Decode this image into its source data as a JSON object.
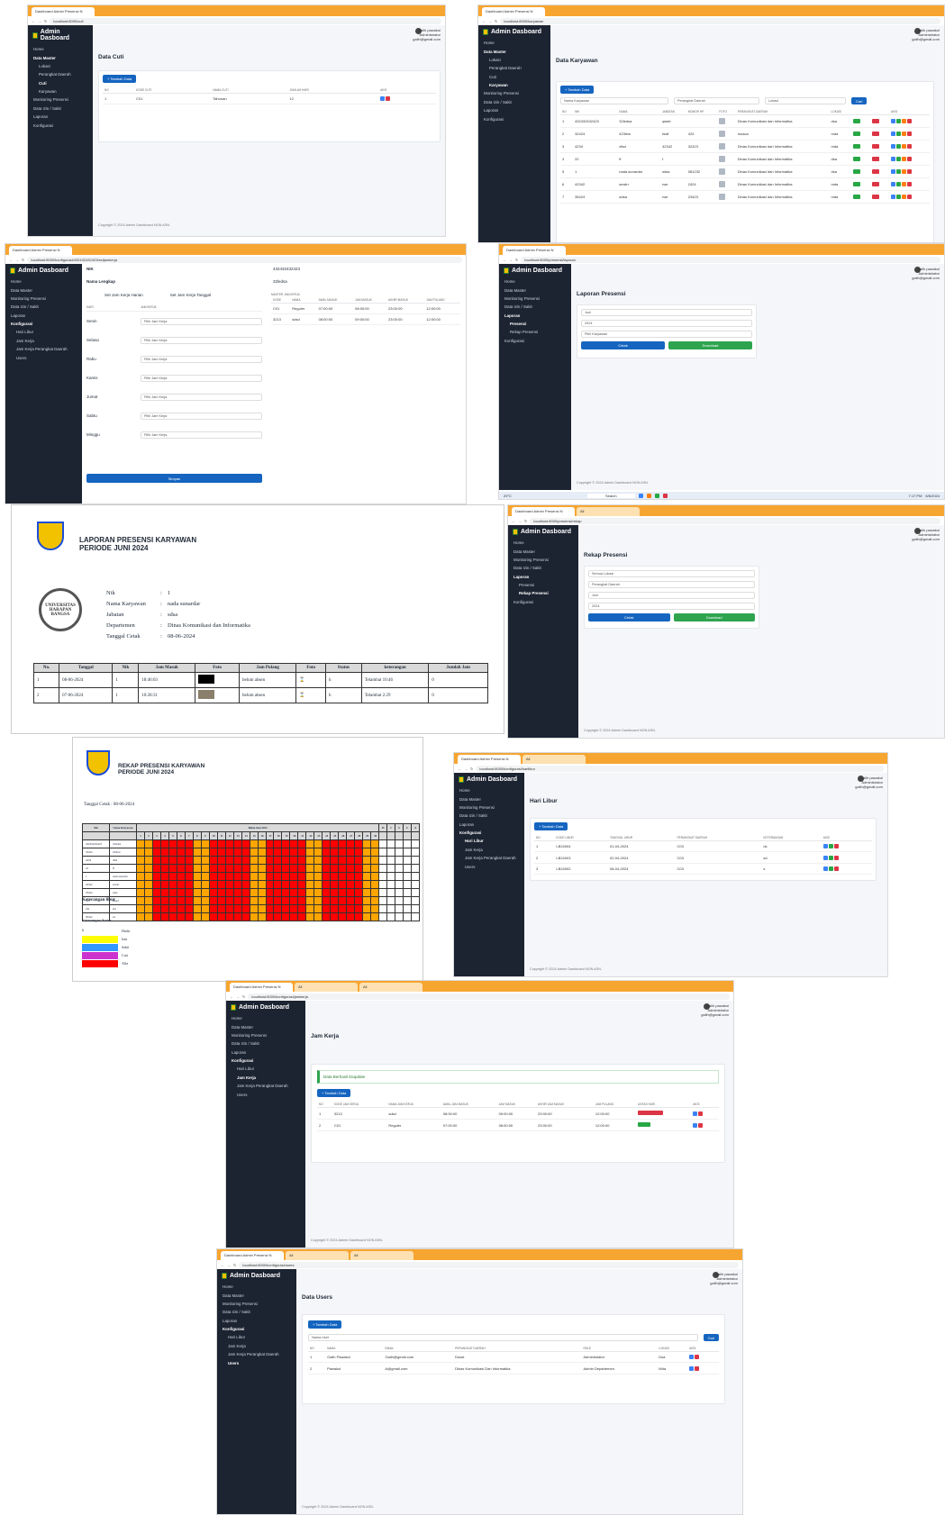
{
  "brand": "Admin Dasboard",
  "user": {
    "name": "galih pawakol",
    "role": "Administrator",
    "email": "galih@gmail.com"
  },
  "footer": "Copyright © 2024 Admin Dashboard NON ASN.",
  "colors": {
    "sidebar": "#1c2331",
    "chrome": "#f7a531",
    "primary": "#1565c0",
    "success": "#2ea44f",
    "danger": "#dc3545",
    "absent": "#ff0000",
    "weekend": "#ffa500"
  },
  "tabs": {
    "main": "Dashboard Admin Presensi N",
    "blank": "All"
  },
  "sidebar": {
    "home": "Home",
    "data_master": "Data Master",
    "lokasi": "Lokasi",
    "perangkat": "Perangkat Daerah",
    "cuti": "Cuti",
    "karyawan": "Karyawan",
    "monitoring": "Monitoring Presensi",
    "izin": "Data Izin / Sakit",
    "laporan": "Laporan",
    "presensi": "Presensi",
    "rekap": "Rekap Presensi",
    "konfigurasi": "Konfigurasi",
    "hari_libur": "Hari Libur",
    "jam_kerja": "Jam Kerja",
    "jam_kerja_pd": "Jam Kerja Perangkat Daerah",
    "users": "Users"
  },
  "s1": {
    "url": "localhost:8000/cuti",
    "title": "Data Cuti",
    "add": "+ Tambah Data",
    "headers": [
      "NO",
      "KODE CUTI",
      "NAMA CUTI",
      "JUMLAH HARI",
      "AKSI"
    ],
    "rows": [
      [
        "1",
        "C01",
        "Tahunan",
        "12"
      ]
    ]
  },
  "s2": {
    "url": "localhost:8000/karyawan",
    "title": "Data Karyawan",
    "add": "+ Tambah Data",
    "search_ph": "Nama Karyawan",
    "pd_ph": "Perangkat Daerah",
    "lok_ph": "Lokasi",
    "cari": "Cari",
    "headers": [
      "NO",
      "NIK",
      "NAMA",
      "JABATAN",
      "NOMOR HP",
      "FOTO",
      "PERANGKAT DAERAH",
      "LOKASI",
      "",
      "",
      "AKSI"
    ],
    "rows": [
      [
        "1",
        "432432432423",
        "32ledsa",
        "qwde",
        "",
        "Dinas Komunikasi dan Informatika",
        "dsa"
      ],
      [
        "2",
        "32424",
        "423lew",
        "fwdf",
        "424",
        "rocaca",
        "mda"
      ],
      [
        "3",
        "4234",
        "dfsd",
        "42342",
        "32423",
        "Dinas Komunikasi dan Informatika",
        "mda"
      ],
      [
        "4",
        "22",
        "ff",
        "f",
        "",
        "Dinas Komunikasi dan Informatika",
        "dsa"
      ],
      [
        "5",
        "1",
        "nada sunardar",
        "sdsa",
        "081232",
        "Dinas Komunikasi dan Informatika",
        "dsa"
      ],
      [
        "6",
        "42342",
        "sewlrr",
        "rwe",
        "2424",
        "Dinas Komunikasi dan Informatika",
        "mda"
      ],
      [
        "7",
        "35424",
        "adsa",
        "rwe",
        "23423",
        "Dinas Komunikasi dan Informatika",
        "mda"
      ]
    ]
  },
  "s3": {
    "url": "localhost:8000/konfigurasi/432432432423/setjamkerja",
    "nik_label": "NIK",
    "nik": "432432432423",
    "nama_label": "Nama Lengkap",
    "nama": "32ledsa",
    "tab1": "Set Jam Kerja Harian",
    "tab2": "Set Jam Kerja Tanggal",
    "col_hari": "HARI",
    "col_jam": "JAM KERJA",
    "days": [
      "Senin",
      "Selasa",
      "Rabu",
      "Kamis",
      "Jumat",
      "Sabtu",
      "Minggu"
    ],
    "pick": "Pilih Jam Kerja",
    "save": "Simpan",
    "master_title": "MASTER JAM KERJA",
    "master_headers": [
      "KODE",
      "NAMA",
      "AWAL MASUK",
      "JAM MASUK",
      "AKHIR MASUK",
      "JAM PULANG"
    ],
    "master_rows": [
      [
        "C01",
        "Reguler",
        "07:00:00",
        "08:00:00",
        "23:00:00",
        "12:00:00"
      ],
      [
        "3213",
        "sdsd",
        "08:00:00",
        "09:00:00",
        "23:00:00",
        "12:00:00"
      ]
    ]
  },
  "s4": {
    "url": "localhost:8000/presensi/laporan",
    "title": "Laporan Presensi",
    "bulan": "Juni",
    "tahun": "2024",
    "karyawan": "Pilih Karyawan",
    "cetak": "Cetak",
    "download": "Download",
    "weather": "29°C",
    "time": "7:17 PM",
    "date": "6/6/2024",
    "search": "Search"
  },
  "doc1": {
    "title1": "LAPORAN PRESENSI KARYAWAN",
    "title2": "PERIODE JUNI 2024",
    "seal": "UNIVERSITAS HARAPAN BANGSA",
    "fields": [
      [
        "Nik",
        ":",
        "1"
      ],
      [
        "Nama Karyawan",
        ":",
        "nada sunardar"
      ],
      [
        "Jabatan",
        ":",
        "sdsa"
      ],
      [
        "Departemen",
        ":",
        "Dinas Komunikasi dan Informatika"
      ],
      [
        "Tanggal Cetak",
        ":",
        "08-06-2024"
      ]
    ],
    "headers": [
      "No.",
      "Tanggal",
      "Nik",
      "Jam Masuk",
      "Foto",
      "Jam Pulang",
      "Foto",
      "Status",
      "keterangan",
      "Jumlah Jam"
    ],
    "rows": [
      [
        "1",
        "08-06-2024",
        "1",
        "18:46:03",
        "",
        "belum absen",
        "",
        "h",
        "Telambat 10:46",
        "0"
      ],
      [
        "2",
        "07-06-2024",
        "1",
        "10:28:31",
        "",
        "belum absen",
        "",
        "h",
        "Telambat 2:29",
        "0"
      ]
    ]
  },
  "s5": {
    "url": "localhost:8000/presensi/rekap",
    "title": "Rekap Presensi",
    "lokasi": "Semua Lokasi",
    "pd": "Perangkat Daerah",
    "bulan": "Juni",
    "tahun": "2024",
    "cetak": "Cetak",
    "download": "Download"
  },
  "doc2": {
    "title1": "REKAP PRESENSI KARYAWAN",
    "title2": "PERIODE JUNI 2024",
    "cetak_label": "Tanggal Cetak",
    "cetak": "08-06-2024",
    "col_nik": "Nik",
    "col_nama": "Nama Karyawan",
    "col_group": "Bulan Juni 2024",
    "tail_cols": [
      "H",
      "I",
      "S",
      "C",
      "A"
    ],
    "ket_libur": "Keterangan libur",
    "ket_status": "Keterangan Status",
    "legend": [
      [
        "h",
        "Hadir",
        "#ffffff"
      ],
      [
        "",
        "Izin",
        "#ffff00"
      ],
      [
        "",
        "Sakit",
        "#3399ff"
      ],
      [
        "",
        "Cuti",
        "#cc33cc"
      ],
      [
        "",
        "Alfa",
        "#ff0000"
      ]
    ],
    "rows": [
      [
        "432432432423",
        "32ledsa"
      ],
      [
        "32424",
        "423lew"
      ],
      [
        "4234",
        "dfsd"
      ],
      [
        "22",
        "ff"
      ],
      [
        "1",
        "nada sunardar"
      ],
      [
        "42342",
        "sewlrr"
      ],
      [
        "35424",
        "adsa"
      ],
      [
        "323",
        "sdsad"
      ],
      [
        "231",
        "sfd"
      ],
      [
        "29342",
        "sd"
      ]
    ]
  },
  "s6": {
    "url": "localhost:8000/konfigurasi/harilibur",
    "title": "Hari Libur",
    "add": "+ Tambah Data",
    "headers": [
      "NO",
      "KODE LIBUR",
      "TANGGAL LIBUR",
      "PERANGKAT DAERAH",
      "KETERANGAN",
      "AKSI"
    ],
    "rows": [
      [
        "1",
        "LB24004",
        "01-04-2024",
        "C03",
        "dc"
      ],
      [
        "2",
        "LB24003",
        "02-04-2024",
        "C03",
        "sd"
      ],
      [
        "3",
        "LB24002",
        "08-04-2024",
        "C03",
        "s"
      ]
    ]
  },
  "s7": {
    "url": "localhost:8000/konfigurasi/jamkerja",
    "title": "Jam Kerja",
    "alert": "Data Berhasil Diupdate",
    "add": "+ Tambah Data",
    "headers": [
      "NO",
      "KODE JAM KERJA",
      "NAMA JAM KERJA",
      "AWAL JAM MASUK",
      "JAM MASUK",
      "AKHIR JAM MASUK",
      "JAM PULANG",
      "LINTAS HARI",
      "AKSI"
    ],
    "rows": [
      [
        "1",
        "3213",
        "sdsd",
        "08:00:00",
        "09:00:00",
        "23:00:00",
        "12:00:00"
      ],
      [
        "2",
        "C01",
        "Reguler",
        "07:00:00",
        "08:00:00",
        "23:00:00",
        "12:00:00"
      ]
    ]
  },
  "s8": {
    "url": "localhost:8000/konfigurasi/users",
    "title": "Data Users",
    "add": "+ Tambah Data",
    "search_ph": "Nama User",
    "cari": "Cari",
    "headers": [
      "NO",
      "NAMA",
      "EMAIL",
      "PERANGKAT DAERAH",
      "ROLE",
      "LOKASI",
      "AKSI"
    ],
    "rows": [
      [
        "1",
        "Galih Pawakol",
        "Galih@gmail.com",
        "Dosst",
        "Administrator",
        "Dsa"
      ],
      [
        "2",
        "Pawakol",
        "A@gmail.com",
        "Dinas Komunikasi Dan Informatika",
        "Admin Departemen",
        "Mda"
      ]
    ]
  }
}
